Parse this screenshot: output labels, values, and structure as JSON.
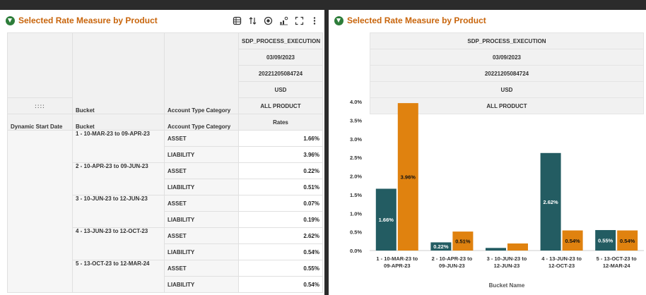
{
  "left_panel": {
    "title": "Selected Rate Measure by Product",
    "toolbar_icons": [
      "pivot-icon",
      "sort-icon",
      "filter-icon",
      "chart-type-icon",
      "fullscreen-icon",
      "more-icon"
    ],
    "header_rows": [
      "SDP_PROCESS_EXECUTION",
      "03/09/2023",
      "20221205084724",
      "USD",
      "ALL PRODUCT"
    ],
    "grip": "::::",
    "columns": {
      "dynamic_start_date": "Dynamic Start Date",
      "bucket": "Bucket",
      "account_type_category": "Account Type Category",
      "rates": "Rates"
    },
    "buckets": [
      {
        "name": "1 - 10-MAR-23 to 09-APR-23",
        "rows": [
          {
            "category": "ASSET",
            "rate": "1.66%"
          },
          {
            "category": "LIABILITY",
            "rate": "3.96%"
          }
        ]
      },
      {
        "name": "2 - 10-APR-23 to 09-JUN-23",
        "rows": [
          {
            "category": "ASSET",
            "rate": "0.22%"
          },
          {
            "category": "LIABILITY",
            "rate": "0.51%"
          }
        ]
      },
      {
        "name": "3 - 10-JUN-23 to 12-JUN-23",
        "rows": [
          {
            "category": "ASSET",
            "rate": "0.07%"
          },
          {
            "category": "LIABILITY",
            "rate": "0.19%"
          }
        ]
      },
      {
        "name": "4 - 13-JUN-23 to 12-OCT-23",
        "rows": [
          {
            "category": "ASSET",
            "rate": "2.62%"
          },
          {
            "category": "LIABILITY",
            "rate": "0.54%"
          }
        ]
      },
      {
        "name": "5 - 13-OCT-23 to 12-MAR-24",
        "rows": [
          {
            "category": "ASSET",
            "rate": "0.55%"
          },
          {
            "category": "LIABILITY",
            "rate": "0.54%"
          }
        ]
      }
    ]
  },
  "right_panel": {
    "title": "Selected Rate Measure by Product",
    "header_rows": [
      "SDP_PROCESS_EXECUTION",
      "03/09/2023",
      "20221205084724",
      "USD",
      "ALL PRODUCT"
    ]
  },
  "colors": {
    "title": "#c8650c",
    "asset": "#235c62",
    "liability": "#e0820f",
    "title_icon": "#2d7d3a"
  },
  "chart_data": {
    "type": "bar",
    "categories": [
      [
        "1 - 10-MAR-23 to",
        "09-APR-23"
      ],
      [
        "2 - 10-APR-23 to",
        "09-JUN-23"
      ],
      [
        "3 - 10-JUN-23 to",
        "12-JUN-23"
      ],
      [
        "4 - 13-JUN-23 to",
        "12-OCT-23"
      ],
      [
        "5 - 13-OCT-23 to",
        "12-MAR-24"
      ]
    ],
    "series": [
      {
        "values": [
          1.66,
          0.22,
          0.07,
          2.62,
          0.55
        ],
        "labels": [
          "1.66%",
          "0.22%",
          "",
          "2.62%",
          "0.55%"
        ]
      },
      {
        "values": [
          3.96,
          0.51,
          0.19,
          0.54,
          0.54
        ],
        "labels": [
          "3.96%",
          "0.51%",
          "",
          "0.54%",
          "0.54%"
        ]
      }
    ],
    "yticks": [
      "0.0%",
      "0.5%",
      "1.0%",
      "1.5%",
      "2.0%",
      "2.5%",
      "3.0%",
      "3.5%",
      "4.0%"
    ],
    "ylim": [
      0,
      4.0
    ],
    "xlabel": "Bucket Name",
    "grid": false,
    "legend": "none"
  }
}
